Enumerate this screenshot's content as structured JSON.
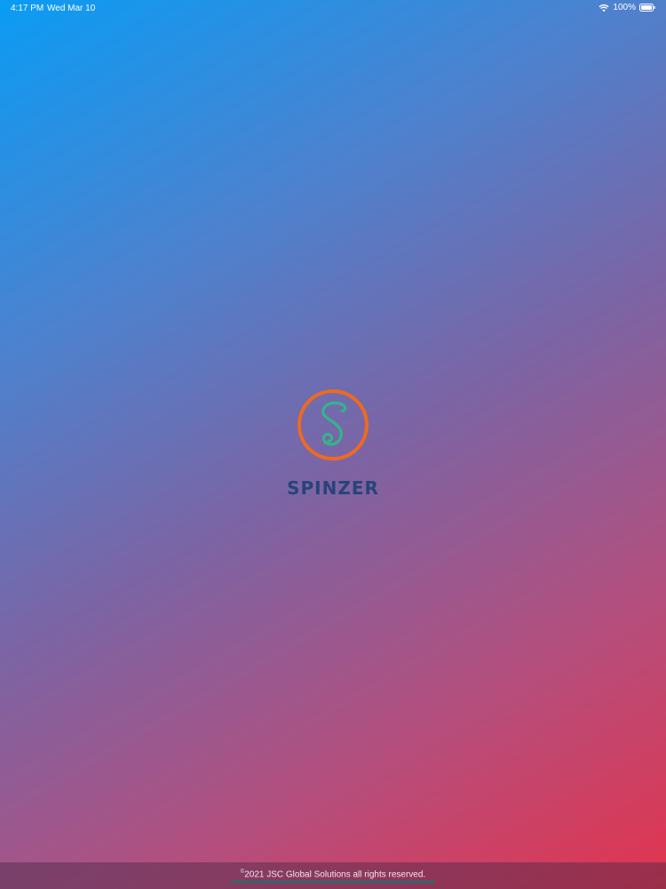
{
  "status_bar": {
    "time": "4:17 PM",
    "date": "Wed Mar 10",
    "battery": "100%",
    "wifi_icon": "wifi-icon",
    "battery_icon": "battery-icon"
  },
  "splash": {
    "app_name": "SPINZER",
    "logo_icon": "spinzer-s-logo",
    "logo_letter": "S"
  },
  "footer": {
    "copyright_symbol": "©",
    "copyright_text": "2021 JSC Global Solutions all rights reserved."
  },
  "colors": {
    "gradient_start": "#0a9cf4",
    "gradient_end": "#e2344e",
    "logo_ring": "#ef6a1f",
    "logo_letter": "#35b48a",
    "app_name": "#27447a"
  }
}
